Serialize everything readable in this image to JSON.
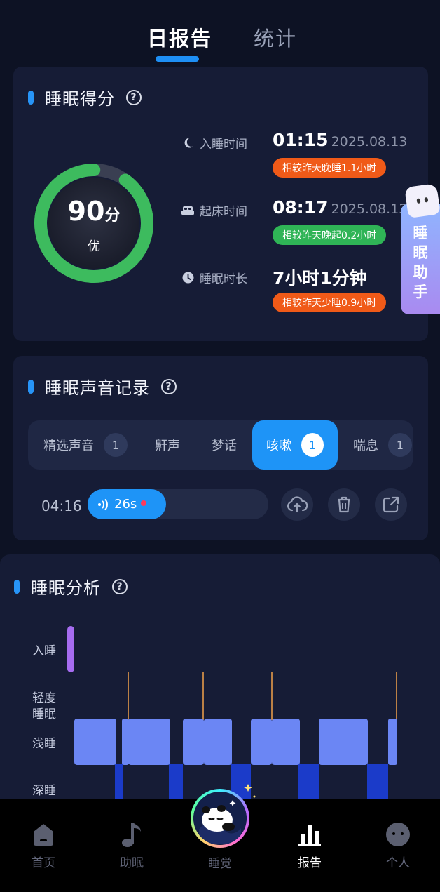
{
  "tabs": {
    "daily": "日报告",
    "stats": "统计"
  },
  "score_card": {
    "title": "睡眠得分",
    "score": "90",
    "score_unit": "分",
    "score_progress": 0.9,
    "grade": "优",
    "sleep_time": {
      "label": "入睡时间",
      "time": "01:15",
      "date": "2025.08.13",
      "compare": "相较昨天晚睡1.1小时"
    },
    "wake_time": {
      "label": "起床时间",
      "time": "08:17",
      "date": "2025.08.13",
      "compare": "相较昨天晚起0.2小时"
    },
    "duration": {
      "label": "睡眠时长",
      "value": "7小时1分钟",
      "compare": "相较昨天少睡0.9小时"
    }
  },
  "assistant": {
    "label": "睡眠助手"
  },
  "sound_card": {
    "title": "睡眠声音记录",
    "segments": [
      {
        "label": "精选声音",
        "count": "1"
      },
      {
        "label": "鼾声"
      },
      {
        "label": "梦话"
      },
      {
        "label": "咳嗽",
        "count": "1",
        "active": true
      },
      {
        "label": "喘息",
        "count": "1"
      }
    ],
    "recording": {
      "time": "04:16",
      "duration": "26s"
    }
  },
  "analysis_card": {
    "title": "睡眠分析",
    "levels": [
      "入睡",
      "轻度\n睡眠",
      "浅睡",
      "深睡"
    ]
  },
  "nav": {
    "home": "首页",
    "aid": "助眠",
    "sleep": "睡觉",
    "report": "报告",
    "me": "个人"
  },
  "colors": {
    "accent": "#1e94f7",
    "orange": "#f05a18",
    "green": "#2fb456",
    "light_sleep": "#6b86f4",
    "deep_sleep": "#1b3bc9",
    "fall_asleep": "#a66cf0"
  }
}
